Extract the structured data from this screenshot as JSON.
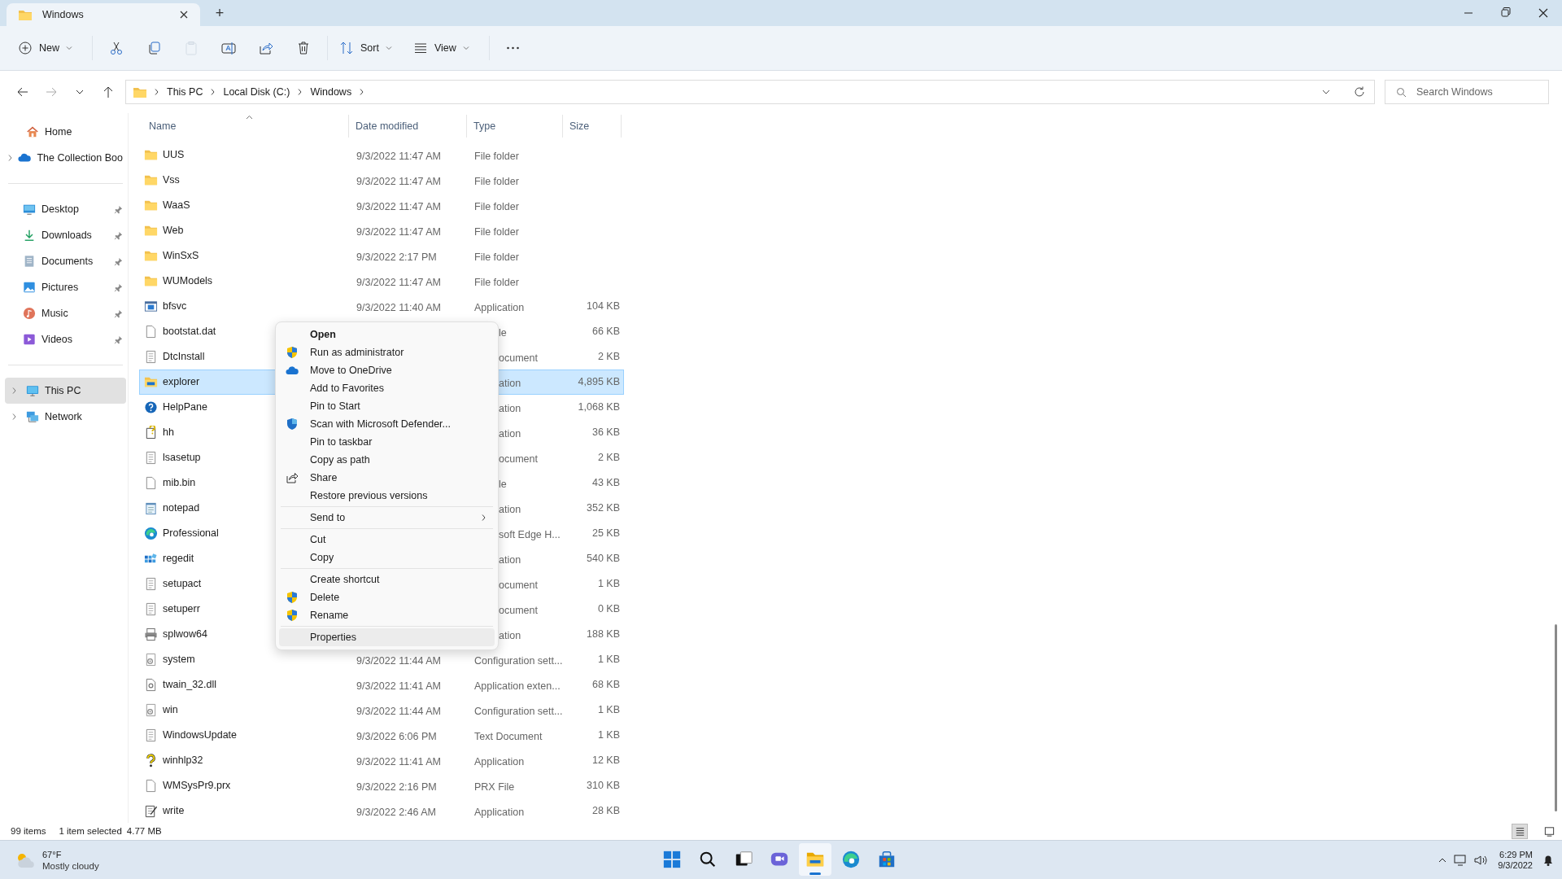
{
  "window": {
    "tabs": [
      {
        "title": "Windows",
        "selected": true
      }
    ],
    "new_tab": "+"
  },
  "toolbar": [
    {
      "label": "New",
      "dropdown": true,
      "disabled": false
    },
    {
      "disabled": false
    },
    {
      "disabled": false
    },
    {
      "disabled": true
    },
    {
      "disabled": false
    },
    {
      "disabled": false
    },
    {
      "disabled": false
    },
    {
      "label": "Sort",
      "dropdown": true,
      "disabled": false
    },
    {
      "label": "View",
      "dropdown": true,
      "disabled": false
    },
    {
      "disabled": false
    }
  ],
  "address": {
    "segments": [
      "This PC",
      "Local Disk (C:)",
      "Windows"
    ]
  },
  "search": {
    "placeholder": "Search Windows"
  },
  "sidebar": {
    "groups": [
      [
        {
          "label": "Home",
          "expandable": false,
          "pinned": false,
          "selected": false
        },
        {
          "label": "The Collection Boo",
          "expandable": true,
          "pinned": false,
          "selected": false
        }
      ],
      [
        {
          "label": "Desktop",
          "expandable": false,
          "pinned": true,
          "selected": false
        },
        {
          "label": "Downloads",
          "expandable": false,
          "pinned": true,
          "selected": false
        },
        {
          "label": "Documents",
          "expandable": false,
          "pinned": true,
          "selected": false
        },
        {
          "label": "Pictures",
          "expandable": false,
          "pinned": true,
          "selected": false
        },
        {
          "label": "Music",
          "expandable": false,
          "pinned": true,
          "selected": false
        },
        {
          "label": "Videos",
          "expandable": false,
          "pinned": true,
          "selected": false
        }
      ],
      [
        {
          "label": "This PC",
          "expandable": true,
          "pinned": false,
          "selected": true
        },
        {
          "label": "Network",
          "expandable": true,
          "pinned": false,
          "selected": false
        }
      ]
    ]
  },
  "table": {
    "columns": [
      {
        "label": "Name",
        "sorted": true
      },
      {
        "label": "Date modified",
        "sorted": false
      },
      {
        "label": "Type",
        "sorted": false
      },
      {
        "label": "Size",
        "sorted": false
      }
    ],
    "rows": [
      {
        "kind": "folder",
        "name": "UUS",
        "date": "9/3/2022 11:47 AM",
        "type": "File folder",
        "selected": false
      },
      {
        "kind": "folder",
        "name": "Vss",
        "date": "9/3/2022 11:47 AM",
        "type": "File folder",
        "selected": false
      },
      {
        "kind": "folder",
        "name": "WaaS",
        "date": "9/3/2022 11:47 AM",
        "type": "File folder",
        "selected": false
      },
      {
        "kind": "folder",
        "name": "Web",
        "date": "9/3/2022 11:47 AM",
        "type": "File folder",
        "selected": false
      },
      {
        "kind": "folder",
        "name": "WinSxS",
        "date": "9/3/2022 2:17 PM",
        "type": "File folder",
        "selected": false
      },
      {
        "kind": "folder",
        "name": "WUModels",
        "date": "9/3/2022 11:47 AM",
        "type": "File folder",
        "selected": false
      },
      {
        "kind": "window",
        "name": "bfsvc",
        "date": "9/3/2022 11:40 AM",
        "type": "Application",
        "size": "104 KB",
        "selected": false
      },
      {
        "kind": "file",
        "name": "bootstat.dat",
        "type": "le",
        "size": "66 KB",
        "selected": false
      },
      {
        "kind": "text",
        "name": "DtcInstall",
        "type": "ocument",
        "size": "2 KB",
        "selected": false
      },
      {
        "kind": "explorer",
        "name": "explorer",
        "type": "ation",
        "size": "4,895 KB",
        "selected": true
      },
      {
        "kind": "help",
        "name": "HelpPane",
        "type": "ation",
        "size": "1,068 KB",
        "selected": false
      },
      {
        "kind": "helpdoc",
        "name": "hh",
        "type": "ation",
        "size": "36 KB",
        "selected": false
      },
      {
        "kind": "text",
        "name": "lsasetup",
        "type": "ocument",
        "size": "2 KB",
        "selected": false
      },
      {
        "kind": "file",
        "name": "mib.bin",
        "type": "le",
        "size": "43 KB",
        "selected": false
      },
      {
        "kind": "notepad",
        "name": "notepad",
        "type": "ation",
        "size": "352 KB",
        "selected": false
      },
      {
        "kind": "edge",
        "name": "Professional",
        "type": "soft Edge H...",
        "size": "25 KB",
        "selected": false
      },
      {
        "kind": "registry",
        "name": "regedit",
        "type": "ation",
        "size": "540 KB",
        "selected": false
      },
      {
        "kind": "text",
        "name": "setupact",
        "type": "ocument",
        "size": "1 KB",
        "selected": false
      },
      {
        "kind": "text",
        "name": "setuperr",
        "type": "ocument",
        "size": "0 KB",
        "selected": false
      },
      {
        "kind": "printer",
        "name": "splwow64",
        "type": "ation",
        "size": "188 KB",
        "selected": false
      },
      {
        "kind": "config",
        "name": "system",
        "date": "9/3/2022 11:44 AM",
        "type": "Configuration sett...",
        "size": "1 KB",
        "selected": false
      },
      {
        "kind": "dll",
        "name": "twain_32.dll",
        "date": "9/3/2022 11:41 AM",
        "type": "Application exten...",
        "size": "68 KB",
        "selected": false
      },
      {
        "kind": "config",
        "name": "win",
        "date": "9/3/2022 11:44 AM",
        "type": "Configuration sett...",
        "size": "1 KB",
        "selected": false
      },
      {
        "kind": "text",
        "name": "WindowsUpdate",
        "date": "9/3/2022 6:06 PM",
        "type": "Text Document",
        "size": "1 KB",
        "selected": false
      },
      {
        "kind": "question",
        "name": "winhlp32",
        "date": "9/3/2022 11:41 AM",
        "type": "Application",
        "size": "12 KB",
        "selected": false
      },
      {
        "kind": "file",
        "name": "WMSysPr9.prx",
        "date": "9/3/2022 2:16 PM",
        "type": "PRX File",
        "size": "310 KB",
        "selected": false
      },
      {
        "kind": "write",
        "name": "write",
        "date": "9/3/2022 2:46 AM",
        "type": "Application",
        "size": "28 KB",
        "selected": false
      }
    ]
  },
  "context_menu": {
    "groups": [
      [
        {
          "label": "Open",
          "default": true,
          "submenu": false,
          "highlighted": false
        },
        {
          "label": "Run as administrator",
          "default": false,
          "submenu": false,
          "highlighted": false
        },
        {
          "label": "Move to OneDrive",
          "default": false,
          "submenu": false,
          "highlighted": false
        },
        {
          "label": "Add to Favorites",
          "default": false,
          "submenu": false,
          "highlighted": false
        },
        {
          "label": "Pin to Start",
          "default": false,
          "submenu": false,
          "highlighted": false
        },
        {
          "label": "Scan with Microsoft Defender...",
          "default": false,
          "submenu": false,
          "highlighted": false
        },
        {
          "label": "Pin to taskbar",
          "default": false,
          "submenu": false,
          "highlighted": false
        },
        {
          "label": "Copy as path",
          "default": false,
          "submenu": false,
          "highlighted": false
        },
        {
          "label": "Share",
          "default": false,
          "submenu": false,
          "highlighted": false
        },
        {
          "label": "Restore previous versions",
          "default": false,
          "submenu": false,
          "highlighted": false
        }
      ],
      [
        {
          "label": "Send to",
          "default": false,
          "submenu": true,
          "highlighted": false
        }
      ],
      [
        {
          "label": "Cut",
          "default": false,
          "submenu": false,
          "highlighted": false
        },
        {
          "label": "Copy",
          "default": false,
          "submenu": false,
          "highlighted": false
        }
      ],
      [
        {
          "label": "Create shortcut",
          "default": false,
          "submenu": false,
          "highlighted": false
        },
        {
          "label": "Delete",
          "default": false,
          "submenu": false,
          "highlighted": false
        },
        {
          "label": "Rename",
          "default": false,
          "submenu": false,
          "highlighted": false
        }
      ],
      [
        {
          "label": "Properties",
          "default": false,
          "submenu": false,
          "highlighted": true
        }
      ]
    ]
  },
  "status_bar": {
    "item_count": "99 items",
    "selection": "1 item selected",
    "selection_size": "4.77 MB",
    "views": [
      {
        "selected": true
      },
      {
        "selected": false
      }
    ]
  },
  "taskbar": {
    "weather": {
      "temperature": "67°F",
      "condition": "Mostly cloudy"
    },
    "apps": [
      {
        "active": false
      },
      {
        "active": false
      },
      {
        "active": false
      },
      {
        "active": false
      },
      {
        "active": true
      },
      {
        "active": false
      },
      {
        "active": false
      }
    ],
    "time": "6:29 PM",
    "date": "9/3/2022"
  }
}
